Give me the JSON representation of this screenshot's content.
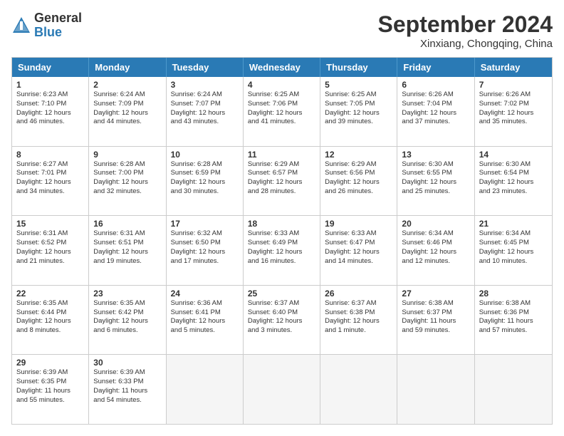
{
  "header": {
    "logo_general": "General",
    "logo_blue": "Blue",
    "month_title": "September 2024",
    "location": "Xinxiang, Chongqing, China"
  },
  "days_of_week": [
    "Sunday",
    "Monday",
    "Tuesday",
    "Wednesday",
    "Thursday",
    "Friday",
    "Saturday"
  ],
  "weeks": [
    [
      {
        "day": "1",
        "lines": [
          "Sunrise: 6:23 AM",
          "Sunset: 7:10 PM",
          "Daylight: 12 hours",
          "and 46 minutes."
        ]
      },
      {
        "day": "2",
        "lines": [
          "Sunrise: 6:24 AM",
          "Sunset: 7:09 PM",
          "Daylight: 12 hours",
          "and 44 minutes."
        ]
      },
      {
        "day": "3",
        "lines": [
          "Sunrise: 6:24 AM",
          "Sunset: 7:07 PM",
          "Daylight: 12 hours",
          "and 43 minutes."
        ]
      },
      {
        "day": "4",
        "lines": [
          "Sunrise: 6:25 AM",
          "Sunset: 7:06 PM",
          "Daylight: 12 hours",
          "and 41 minutes."
        ]
      },
      {
        "day": "5",
        "lines": [
          "Sunrise: 6:25 AM",
          "Sunset: 7:05 PM",
          "Daylight: 12 hours",
          "and 39 minutes."
        ]
      },
      {
        "day": "6",
        "lines": [
          "Sunrise: 6:26 AM",
          "Sunset: 7:04 PM",
          "Daylight: 12 hours",
          "and 37 minutes."
        ]
      },
      {
        "day": "7",
        "lines": [
          "Sunrise: 6:26 AM",
          "Sunset: 7:02 PM",
          "Daylight: 12 hours",
          "and 35 minutes."
        ]
      }
    ],
    [
      {
        "day": "8",
        "lines": [
          "Sunrise: 6:27 AM",
          "Sunset: 7:01 PM",
          "Daylight: 12 hours",
          "and 34 minutes."
        ]
      },
      {
        "day": "9",
        "lines": [
          "Sunrise: 6:28 AM",
          "Sunset: 7:00 PM",
          "Daylight: 12 hours",
          "and 32 minutes."
        ]
      },
      {
        "day": "10",
        "lines": [
          "Sunrise: 6:28 AM",
          "Sunset: 6:59 PM",
          "Daylight: 12 hours",
          "and 30 minutes."
        ]
      },
      {
        "day": "11",
        "lines": [
          "Sunrise: 6:29 AM",
          "Sunset: 6:57 PM",
          "Daylight: 12 hours",
          "and 28 minutes."
        ]
      },
      {
        "day": "12",
        "lines": [
          "Sunrise: 6:29 AM",
          "Sunset: 6:56 PM",
          "Daylight: 12 hours",
          "and 26 minutes."
        ]
      },
      {
        "day": "13",
        "lines": [
          "Sunrise: 6:30 AM",
          "Sunset: 6:55 PM",
          "Daylight: 12 hours",
          "and 25 minutes."
        ]
      },
      {
        "day": "14",
        "lines": [
          "Sunrise: 6:30 AM",
          "Sunset: 6:54 PM",
          "Daylight: 12 hours",
          "and 23 minutes."
        ]
      }
    ],
    [
      {
        "day": "15",
        "lines": [
          "Sunrise: 6:31 AM",
          "Sunset: 6:52 PM",
          "Daylight: 12 hours",
          "and 21 minutes."
        ]
      },
      {
        "day": "16",
        "lines": [
          "Sunrise: 6:31 AM",
          "Sunset: 6:51 PM",
          "Daylight: 12 hours",
          "and 19 minutes."
        ]
      },
      {
        "day": "17",
        "lines": [
          "Sunrise: 6:32 AM",
          "Sunset: 6:50 PM",
          "Daylight: 12 hours",
          "and 17 minutes."
        ]
      },
      {
        "day": "18",
        "lines": [
          "Sunrise: 6:33 AM",
          "Sunset: 6:49 PM",
          "Daylight: 12 hours",
          "and 16 minutes."
        ]
      },
      {
        "day": "19",
        "lines": [
          "Sunrise: 6:33 AM",
          "Sunset: 6:47 PM",
          "Daylight: 12 hours",
          "and 14 minutes."
        ]
      },
      {
        "day": "20",
        "lines": [
          "Sunrise: 6:34 AM",
          "Sunset: 6:46 PM",
          "Daylight: 12 hours",
          "and 12 minutes."
        ]
      },
      {
        "day": "21",
        "lines": [
          "Sunrise: 6:34 AM",
          "Sunset: 6:45 PM",
          "Daylight: 12 hours",
          "and 10 minutes."
        ]
      }
    ],
    [
      {
        "day": "22",
        "lines": [
          "Sunrise: 6:35 AM",
          "Sunset: 6:44 PM",
          "Daylight: 12 hours",
          "and 8 minutes."
        ]
      },
      {
        "day": "23",
        "lines": [
          "Sunrise: 6:35 AM",
          "Sunset: 6:42 PM",
          "Daylight: 12 hours",
          "and 6 minutes."
        ]
      },
      {
        "day": "24",
        "lines": [
          "Sunrise: 6:36 AM",
          "Sunset: 6:41 PM",
          "Daylight: 12 hours",
          "and 5 minutes."
        ]
      },
      {
        "day": "25",
        "lines": [
          "Sunrise: 6:37 AM",
          "Sunset: 6:40 PM",
          "Daylight: 12 hours",
          "and 3 minutes."
        ]
      },
      {
        "day": "26",
        "lines": [
          "Sunrise: 6:37 AM",
          "Sunset: 6:38 PM",
          "Daylight: 12 hours",
          "and 1 minute."
        ]
      },
      {
        "day": "27",
        "lines": [
          "Sunrise: 6:38 AM",
          "Sunset: 6:37 PM",
          "Daylight: 11 hours",
          "and 59 minutes."
        ]
      },
      {
        "day": "28",
        "lines": [
          "Sunrise: 6:38 AM",
          "Sunset: 6:36 PM",
          "Daylight: 11 hours",
          "and 57 minutes."
        ]
      }
    ],
    [
      {
        "day": "29",
        "lines": [
          "Sunrise: 6:39 AM",
          "Sunset: 6:35 PM",
          "Daylight: 11 hours",
          "and 55 minutes."
        ]
      },
      {
        "day": "30",
        "lines": [
          "Sunrise: 6:39 AM",
          "Sunset: 6:33 PM",
          "Daylight: 11 hours",
          "and 54 minutes."
        ]
      },
      {
        "day": "",
        "lines": []
      },
      {
        "day": "",
        "lines": []
      },
      {
        "day": "",
        "lines": []
      },
      {
        "day": "",
        "lines": []
      },
      {
        "day": "",
        "lines": []
      }
    ]
  ]
}
